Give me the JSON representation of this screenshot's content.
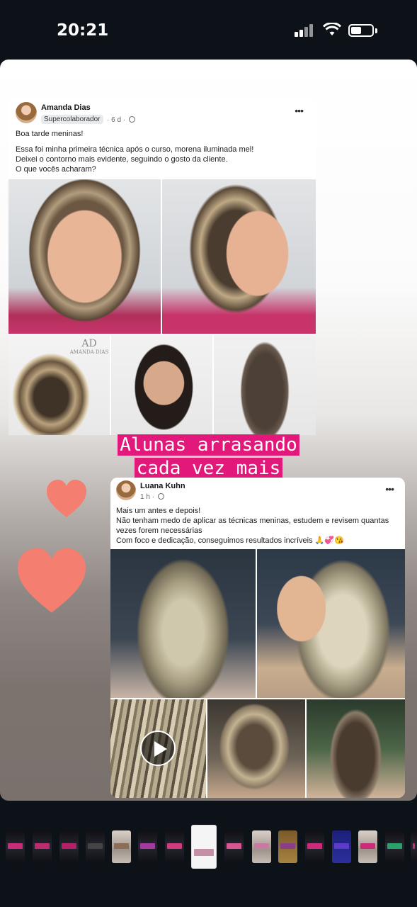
{
  "status_bar": {
    "time": "20:21"
  },
  "post1": {
    "author": "Amanda Dias",
    "badge": "Supercolaborador",
    "meta": "· 6 d ·",
    "more": "•••",
    "text_lines": [
      "Boa tarde meninas!",
      "Essa foi minha primeira técnica após o curso, morena iluminada mel!",
      "Deixei o contorno mais evidente, seguindo o gosto da cliente.",
      "O que vocês acharam?"
    ]
  },
  "overlay": {
    "line1": "Alunas arrasando",
    "line2": "cada vez mais",
    "highlight_color": "#e2197a",
    "heart_color": "#f47f71"
  },
  "post2": {
    "author": "Luana Kuhn",
    "meta": "1 h ·",
    "more": "•••",
    "text_lines": [
      "Mais um antes e depois!",
      "Não tenham medo de aplicar as técnicas meninas, estudem e revisem quantas vezes forem necessárias",
      "Com foco e dedicação, conseguimos resultados incríveis 🙏💞😘"
    ]
  },
  "thumbnails": {
    "count": 17,
    "active_index": 7
  }
}
